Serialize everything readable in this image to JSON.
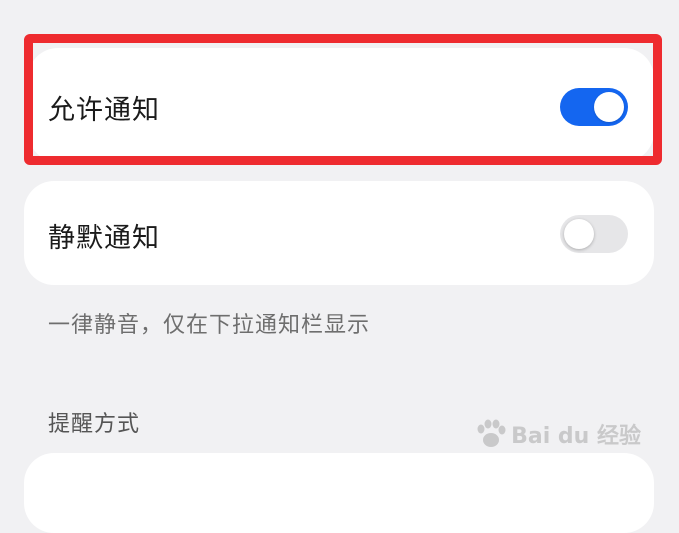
{
  "allow_notifications": {
    "label": "允许通知",
    "enabled": true
  },
  "silent_notifications": {
    "label": "静默通知",
    "enabled": false,
    "description": "一律静音，仅在下拉通知栏显示"
  },
  "reminder_section": {
    "title": "提醒方式"
  },
  "watermark": {
    "text": "Bai du 经验"
  },
  "colors": {
    "accent": "#1466f0",
    "highlight": "#ee2b2f",
    "background": "#f1f1f3"
  }
}
